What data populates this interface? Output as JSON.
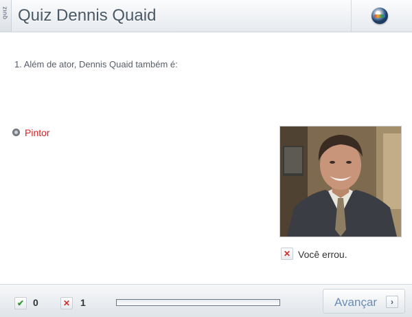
{
  "header": {
    "tab_label": "QUIZ",
    "title": "Quiz Dennis Quaid",
    "logo_icon": "globo-logo-icon"
  },
  "question": {
    "text": "1. Além de ator, Dennis Quaid também é:"
  },
  "options": [
    {
      "label": "Pintor",
      "state": "selected-wrong",
      "color": "#e02020"
    }
  ],
  "photo": {
    "subject": "portrait-photo"
  },
  "feedback": {
    "icon": "x-icon",
    "text": "Você errou."
  },
  "footer": {
    "correct_icon": "check-icon",
    "correct_count": "0",
    "wrong_icon": "x-icon",
    "wrong_count": "1",
    "progress_fraction": 0,
    "next_label": "Avançar",
    "next_icon": "chevron-right-icon"
  },
  "colors": {
    "accent": "#6b8cb8",
    "error": "#d12a2a",
    "correct": "#2e9a2e"
  }
}
